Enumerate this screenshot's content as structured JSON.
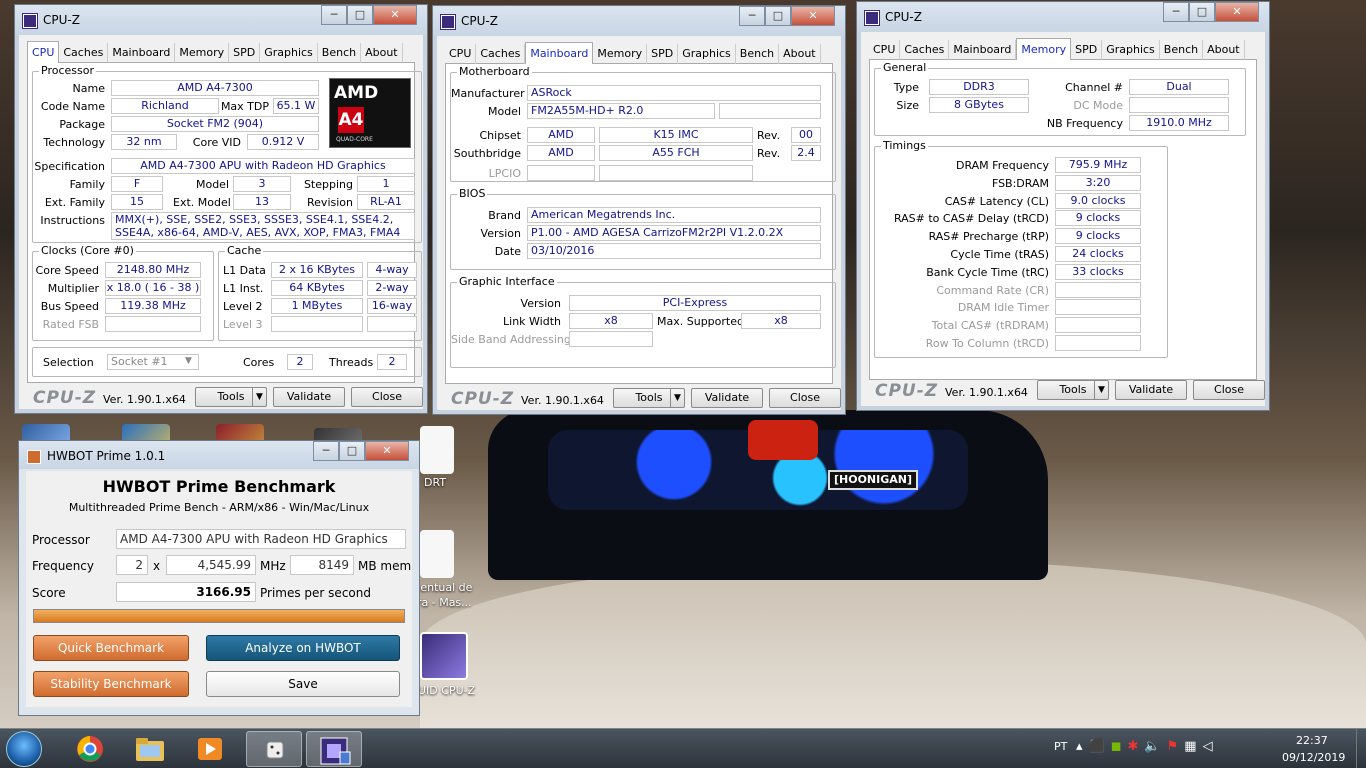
{
  "cpuz_common": {
    "title": "CPU-Z",
    "tabs": [
      "CPU",
      "Caches",
      "Mainboard",
      "Memory",
      "SPD",
      "Graphics",
      "Bench",
      "About"
    ],
    "logo": "CPU-Z",
    "version": "Ver. 1.90.1.x64",
    "tools": "Tools",
    "validate": "Validate",
    "close": "Close"
  },
  "cpu_window": {
    "active_tab": "CPU",
    "processor": {
      "group": "Processor",
      "name_label": "Name",
      "name": "AMD A4-7300",
      "codename_label": "Code Name",
      "codename": "Richland",
      "maxtdp_label": "Max TDP",
      "maxtdp": "65.1 W",
      "package_label": "Package",
      "package": "Socket FM2 (904)",
      "technology_label": "Technology",
      "technology": "32 nm",
      "corevid_label": "Core VID",
      "corevid": "0.912 V",
      "spec_label": "Specification",
      "spec": "AMD A4-7300 APU with Radeon HD Graphics",
      "family_label": "Family",
      "family": "F",
      "model_label": "Model",
      "model": "3",
      "stepping_label": "Stepping",
      "stepping": "1",
      "extfamily_label": "Ext. Family",
      "extfamily": "15",
      "extmodel_label": "Ext. Model",
      "extmodel": "13",
      "revision_label": "Revision",
      "revision": "RL-A1",
      "instructions_label": "Instructions",
      "instructions": "MMX(+), SSE, SSE2, SSE3, SSSE3, SSE4.1, SSE4.2, SSE4A, x86-64, AMD-V, AES, AVX, XOP, FMA3, FMA4",
      "logo_brand": "AMD",
      "logo_model": "A4",
      "logo_sub": "QUAD-CORE"
    },
    "clocks": {
      "group": "Clocks (Core #0)",
      "corespeed_label": "Core Speed",
      "corespeed": "2148.80 MHz",
      "multiplier_label": "Multiplier",
      "multiplier": "x 18.0 ( 16 - 38 )",
      "busspeed_label": "Bus Speed",
      "busspeed": "119.38 MHz",
      "ratedfsb_label": "Rated FSB",
      "ratedfsb": ""
    },
    "cache": {
      "group": "Cache",
      "l1data_label": "L1 Data",
      "l1data": "2 x 16 KBytes",
      "l1data_way": "4-way",
      "l1inst_label": "L1 Inst.",
      "l1inst": "64 KBytes",
      "l1inst_way": "2-way",
      "level2_label": "Level 2",
      "level2": "1 MBytes",
      "level2_way": "16-way",
      "level3_label": "Level 3",
      "level3": "",
      "level3_way": ""
    },
    "selection_label": "Selection",
    "selection": "Socket #1",
    "cores_label": "Cores",
    "cores": "2",
    "threads_label": "Threads",
    "threads": "2"
  },
  "mainboard_window": {
    "active_tab": "Mainboard",
    "motherboard": {
      "group": "Motherboard",
      "manufacturer_label": "Manufacturer",
      "manufacturer": "ASRock",
      "model_label": "Model",
      "model": "FM2A55M-HD+ R2.0",
      "model_extra": "",
      "chipset_label": "Chipset",
      "chipset_vendor": "AMD",
      "chipset": "K15 IMC",
      "chipset_rev_label": "Rev.",
      "chipset_rev": "00",
      "southbridge_label": "Southbridge",
      "southbridge_vendor": "AMD",
      "southbridge": "A55 FCH",
      "southbridge_rev_label": "Rev.",
      "southbridge_rev": "2.4",
      "lpcio_label": "LPCIO",
      "lpcio_vendor": "",
      "lpcio": ""
    },
    "bios": {
      "group": "BIOS",
      "brand_label": "Brand",
      "brand": "American Megatrends Inc.",
      "version_label": "Version",
      "version": "P1.00 - AMD AGESA CarrizoFM2r2PI  V1.2.0.2X",
      "date_label": "Date",
      "date": "03/10/2016"
    },
    "graphic": {
      "group": "Graphic Interface",
      "version_label": "Version",
      "version": "PCI-Express",
      "linkwidth_label": "Link Width",
      "linkwidth": "x8",
      "maxsupported_label": "Max. Supported",
      "maxsupported": "x8",
      "sideband_label": "Side Band Addressing",
      "sideband": ""
    }
  },
  "memory_window": {
    "active_tab": "Memory",
    "general": {
      "group": "General",
      "type_label": "Type",
      "type": "DDR3",
      "channel_label": "Channel #",
      "channel": "Dual",
      "size_label": "Size",
      "size": "8 GBytes",
      "dcmode_label": "DC Mode",
      "dcmode": "",
      "nbfreq_label": "NB Frequency",
      "nbfreq": "1910.0 MHz"
    },
    "timings": {
      "group": "Timings",
      "rows": [
        {
          "label": "DRAM Frequency",
          "value": "795.9 MHz",
          "dim": false
        },
        {
          "label": "FSB:DRAM",
          "value": "3:20",
          "dim": false
        },
        {
          "label": "CAS# Latency (CL)",
          "value": "9.0 clocks",
          "dim": false
        },
        {
          "label": "RAS# to CAS# Delay (tRCD)",
          "value": "9 clocks",
          "dim": false
        },
        {
          "label": "RAS# Precharge (tRP)",
          "value": "9 clocks",
          "dim": false
        },
        {
          "label": "Cycle Time (tRAS)",
          "value": "24 clocks",
          "dim": false
        },
        {
          "label": "Bank Cycle Time (tRC)",
          "value": "33 clocks",
          "dim": false
        },
        {
          "label": "Command Rate (CR)",
          "value": "",
          "dim": true
        },
        {
          "label": "DRAM Idle Timer",
          "value": "",
          "dim": true
        },
        {
          "label": "Total CAS# (tRDRAM)",
          "value": "",
          "dim": true
        },
        {
          "label": "Row To Column (tRCD)",
          "value": "",
          "dim": true
        }
      ]
    }
  },
  "hwbot": {
    "window_title": "HWBOT Prime 1.0.1",
    "heading": "HWBOT Prime Benchmark",
    "subheading": "Multithreaded Prime Bench - ARM/x86 - Win/Mac/Linux",
    "processor_label": "Processor",
    "processor": "AMD A4-7300 APU with Radeon HD Graphics",
    "frequency_label": "Frequency",
    "cores": "2",
    "x": "x",
    "frequency": "4,545.99",
    "mhz": "MHz",
    "mem": "8149",
    "mem_label": "MB mem",
    "score_label": "Score",
    "score": "3166.95",
    "score_unit": "Primes per second",
    "progress": 1.0,
    "quick_benchmark": "Quick Benchmark",
    "analyze": "Analyze on HWBOT",
    "stability_benchmark": "Stability Benchmark",
    "save": "Save"
  },
  "desktop": {
    "car_plate": "[HOONIGAN]",
    "icon_labels": [
      "DRT",
      "rcentual de\nura - Mas...",
      "UID CPU-Z"
    ]
  },
  "taskbar": {
    "lang": "PT",
    "time": "22:37",
    "date": "09/12/2019"
  },
  "colors": {
    "value_text": "#14148c",
    "active_tab_text": "#1a2bbd",
    "hwbot_orange": "#d06b2f",
    "hwbot_blue": "#155579"
  }
}
